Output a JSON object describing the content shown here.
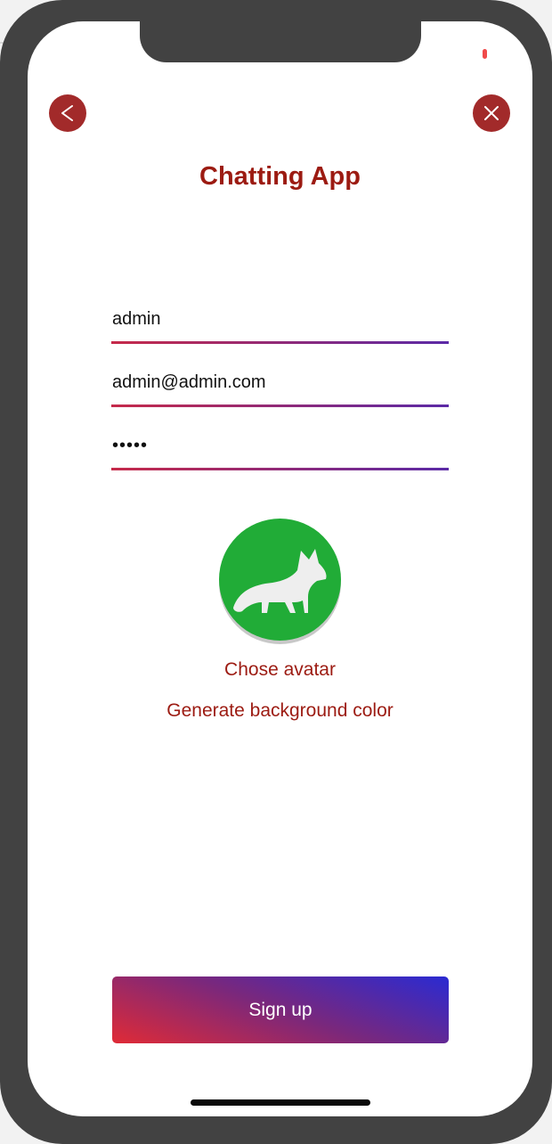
{
  "header": {
    "title": "Chatting App",
    "back_icon": "chevron-left-icon",
    "close_icon": "close-icon"
  },
  "form": {
    "username_value": "admin",
    "email_value": "admin@admin.com",
    "password_masked": "•••••"
  },
  "avatar": {
    "icon": "fox-icon",
    "background_color": "#21ac37",
    "choose_label": "Chose avatar",
    "generate_label": "Generate background color"
  },
  "actions": {
    "signup_label": "Sign up"
  },
  "colors": {
    "accent": "#9c1b12",
    "button_red": "#a22a2a",
    "gradient_start": "#e02a36",
    "gradient_end": "#2a2ad2"
  }
}
